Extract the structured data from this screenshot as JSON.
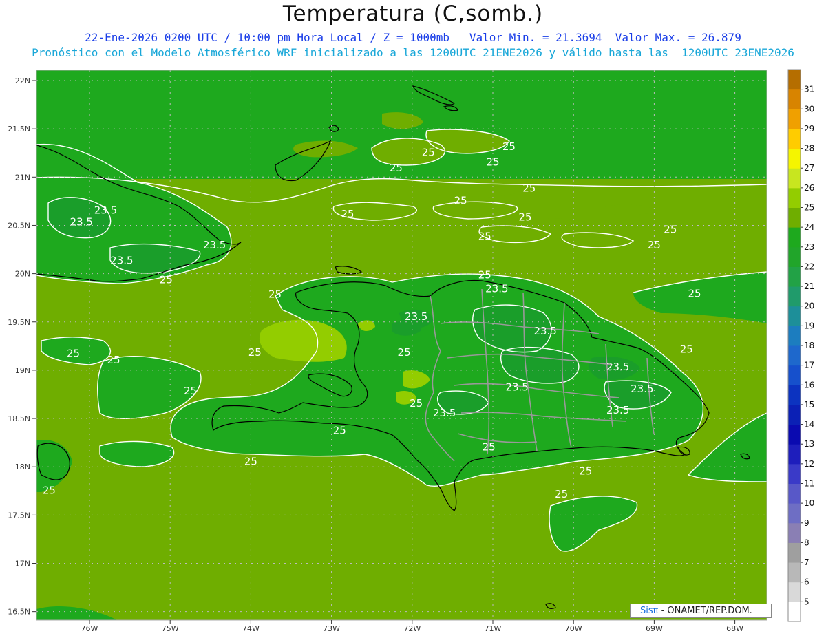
{
  "title": "Temperatura (C,somb.)",
  "subtitle_line1": "22-Ene-2026 0200 UTC / 10:00 pm Hora Local / Z = 1000mb   Valor Min. = 21.3694  Valor Max. = 26.879",
  "subtitle_line2": "Pronóstico con el Modelo Atmosférico WRF inicializado a las 1200UTC_21ENE2026 y válido hasta las  1200UTC_23ENE2026",
  "credit": {
    "brand": "Sisπ",
    "text": " - ONAMET/REP.DOM."
  },
  "colors": {
    "c24": "#1ea91e",
    "c25": "#6fae00",
    "c26": "#93cd00",
    "border": "#999999",
    "contour": "#ffffff",
    "coast": "#000000"
  },
  "chart_data": {
    "type": "heatmap",
    "lat_ticks": [
      "22N",
      "21.5N",
      "21N",
      "20.5N",
      "20N",
      "19.5N",
      "19N",
      "18.5N",
      "18N",
      "17.5N",
      "17N",
      "16.5N"
    ],
    "lon_ticks": [
      "76W",
      "75W",
      "74W",
      "73W",
      "72W",
      "71W",
      "70W",
      "69W",
      "68W"
    ],
    "value_range": [
      21.3694,
      26.879
    ],
    "colorbar": {
      "levels": [
        5,
        6,
        7,
        8,
        9,
        10,
        11,
        12,
        13,
        14,
        15,
        16,
        17,
        18,
        19,
        20,
        21,
        22,
        23,
        24,
        25,
        26,
        27,
        28,
        29,
        30,
        31
      ],
      "colors": [
        "#ffffff",
        "#d9d9d9",
        "#b8b8b8",
        "#9f9f9f",
        "#8a7fb4",
        "#6e6ec4",
        "#5858c8",
        "#3a3ac8",
        "#1e1ebc",
        "#0a0ab0",
        "#0b20b5",
        "#0c33c0",
        "#1650cc",
        "#1e68cc",
        "#1c7dbf",
        "#1d8f99",
        "#209b6b",
        "#22a246",
        "#21a52a",
        "#1ea91e",
        "#6fae00",
        "#93cd00",
        "#c8e61f",
        "#f5f500",
        "#ffcc00",
        "#f0a000",
        "#d88400",
        "#b56e00"
      ]
    },
    "contour_labels": [
      {
        "text": "25",
        "lon": -70.8,
        "lat": 21.28
      },
      {
        "text": "25",
        "lon": -71.8,
        "lat": 21.22
      },
      {
        "text": "25",
        "lon": -71.0,
        "lat": 21.12
      },
      {
        "text": "25",
        "lon": -72.2,
        "lat": 21.06
      },
      {
        "text": "25",
        "lon": -70.55,
        "lat": 20.85
      },
      {
        "text": "25",
        "lon": -71.4,
        "lat": 20.72
      },
      {
        "text": "25",
        "lon": -72.8,
        "lat": 20.58
      },
      {
        "text": "25",
        "lon": -70.6,
        "lat": 20.55
      },
      {
        "text": "25",
        "lon": -68.8,
        "lat": 20.42
      },
      {
        "text": "25",
        "lon": -71.1,
        "lat": 20.35
      },
      {
        "text": "25",
        "lon": -69.0,
        "lat": 20.26
      },
      {
        "text": "23.5",
        "lon": -75.8,
        "lat": 20.62
      },
      {
        "text": "23.5",
        "lon": -76.1,
        "lat": 20.5
      },
      {
        "text": "23.5",
        "lon": -74.45,
        "lat": 20.26
      },
      {
        "text": "23.5",
        "lon": -75.6,
        "lat": 20.1
      },
      {
        "text": "25",
        "lon": -75.05,
        "lat": 19.9
      },
      {
        "text": "25",
        "lon": -71.1,
        "lat": 19.95
      },
      {
        "text": "23.5",
        "lon": -70.95,
        "lat": 19.81
      },
      {
        "text": "25",
        "lon": -73.7,
        "lat": 19.75
      },
      {
        "text": "25",
        "lon": -68.5,
        "lat": 19.76
      },
      {
        "text": "25",
        "lon": -67.5,
        "lat": 19.78
      },
      {
        "text": "23.5",
        "lon": -71.95,
        "lat": 19.52
      },
      {
        "text": "23.5",
        "lon": -70.35,
        "lat": 19.37
      },
      {
        "text": "25",
        "lon": -76.2,
        "lat": 19.14
      },
      {
        "text": "25",
        "lon": -75.7,
        "lat": 19.07
      },
      {
        "text": "25",
        "lon": -73.95,
        "lat": 19.15
      },
      {
        "text": "25",
        "lon": -72.1,
        "lat": 19.15
      },
      {
        "text": "25",
        "lon": -68.6,
        "lat": 19.18
      },
      {
        "text": "23.5",
        "lon": -69.45,
        "lat": 19.0
      },
      {
        "text": "23.5",
        "lon": -70.7,
        "lat": 18.79
      },
      {
        "text": "23.5",
        "lon": -69.15,
        "lat": 18.77
      },
      {
        "text": "25",
        "lon": -74.75,
        "lat": 18.75
      },
      {
        "text": "25",
        "lon": -71.95,
        "lat": 18.62
      },
      {
        "text": "23.5",
        "lon": -71.6,
        "lat": 18.52
      },
      {
        "text": "23.5",
        "lon": -69.45,
        "lat": 18.55
      },
      {
        "text": "25",
        "lon": -72.9,
        "lat": 18.34
      },
      {
        "text": "25",
        "lon": -71.05,
        "lat": 18.17
      },
      {
        "text": "25",
        "lon": -74.0,
        "lat": 18.02
      },
      {
        "text": "25",
        "lon": -76.5,
        "lat": 17.72
      },
      {
        "text": "25",
        "lon": -69.85,
        "lat": 17.92
      },
      {
        "text": "25",
        "lon": -70.15,
        "lat": 17.68
      }
    ]
  }
}
